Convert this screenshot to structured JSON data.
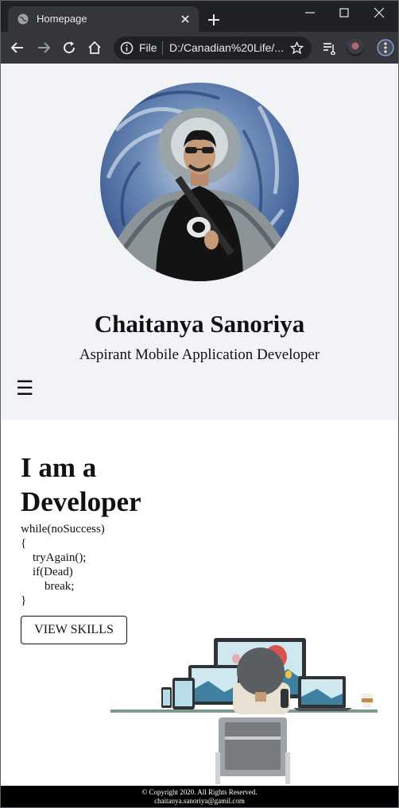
{
  "browser": {
    "tab_title": "Homepage",
    "url_scheme": "File",
    "url": "D:/Canadian%20Life/...",
    "icons": [
      "globe-icon",
      "close-icon",
      "plus-icon",
      "minimize-icon",
      "maximize-icon",
      "close-window-icon",
      "back-icon",
      "forward-icon",
      "reload-icon",
      "home-icon",
      "info-icon",
      "star-icon",
      "reading-list-icon",
      "more-icon"
    ]
  },
  "header": {
    "name": "Chaitanya Sanoriya",
    "role": "Aspirant Mobile Application Developer",
    "menu_icon": "☰"
  },
  "main": {
    "headline_line1": "I am a",
    "headline_line2": "Developer",
    "code": [
      "while(noSuccess)",
      "{",
      "    tryAgain();",
      "    if(Dead)",
      "        break;",
      "}"
    ],
    "button_label": "VIEW SKILLS"
  },
  "footer": {
    "copyright": "© Copyright 2020. All Rights Reserved.",
    "email": "chaitanya.sanoriya@gamil.com"
  },
  "colors": {
    "chrome_dark": "#202124",
    "chrome_toolbar": "#35363a",
    "header_bg": "#f2f3f7",
    "footer_bg": "#000000"
  }
}
